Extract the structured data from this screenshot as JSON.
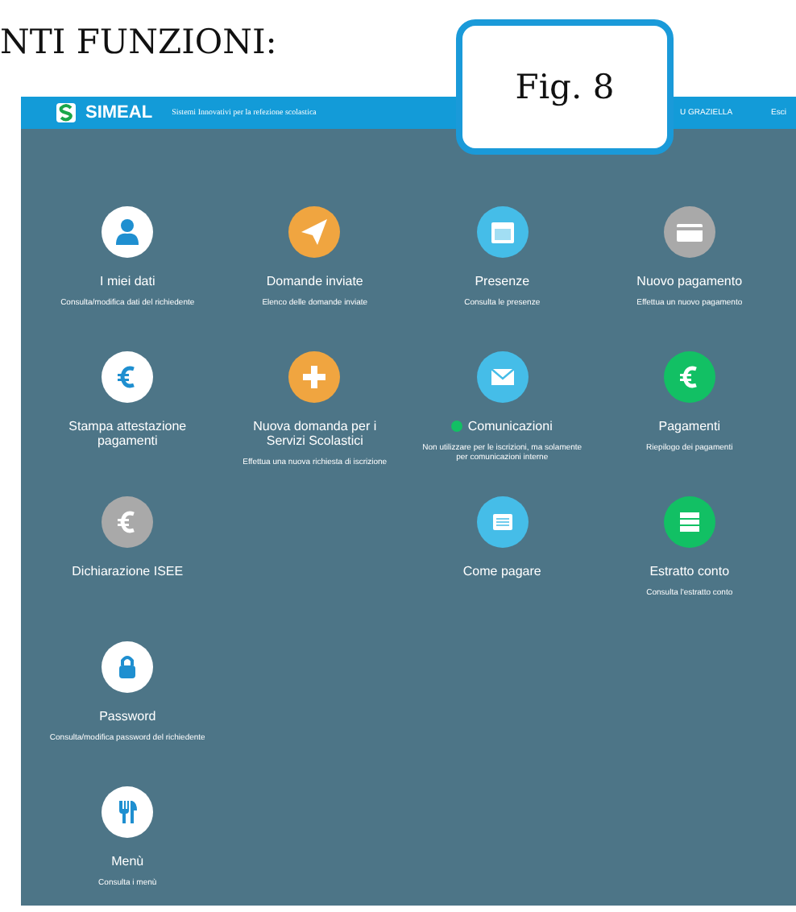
{
  "heading": "NTI FUNZIONI:",
  "callout": {
    "label": "Fig. 8"
  },
  "header": {
    "brand": "SIMEAL",
    "tagline": "Sistemi Innovativi per la refezione scolastica",
    "user": "U GRAZIELLA",
    "logout": "Esci"
  },
  "rows": [
    [
      {
        "kind": "person",
        "color": "#ffffff",
        "title": "I miei dati",
        "subtitle": "Consulta/modifica dati del richiedente",
        "dot": false
      },
      {
        "kind": "plane",
        "color": "#f0a540",
        "title": "Domande inviate",
        "subtitle": "Elenco delle domande inviate",
        "dot": false
      },
      {
        "kind": "calendar",
        "color": "#45bde8",
        "title": "Presenze",
        "subtitle": "Consulta le presenze",
        "dot": false
      },
      {
        "kind": "card",
        "color": "#a9a9a9",
        "title": "Nuovo pagamento",
        "subtitle": "Effettua un nuovo pagamento",
        "dot": false
      }
    ],
    [
      {
        "kind": "euro",
        "color": "#ffffff",
        "title": "Stampa attestazione pagamenti",
        "dot": false
      },
      {
        "kind": "plus",
        "color": "#f0a540",
        "title": "Nuova domanda per i Servizi Scolastici",
        "subtitle": "Effettua una nuova richiesta di iscrizione",
        "dot": false
      },
      {
        "kind": "mail",
        "color": "#45bde8",
        "title": "Comunicazioni",
        "subtitle": "Non utilizzare per le iscrizioni, ma solamente per comunicazioni interne",
        "dot": true
      },
      {
        "kind": "euro",
        "color": "#12c064",
        "title": "Pagamenti",
        "subtitle": "Riepilogo dei pagamenti",
        "dot": false
      }
    ],
    [
      {
        "kind": "euro",
        "color": "#a9a9a9",
        "title": "Dichiarazione ISEE",
        "dot": false
      },
      null,
      {
        "kind": "list",
        "color": "#45bde8",
        "title": "Come pagare",
        "dot": false
      },
      {
        "kind": "ledger",
        "color": "#12c064",
        "title": "Estratto conto",
        "subtitle": "Consulta l'estratto conto",
        "dot": false
      }
    ],
    [
      {
        "kind": "lock",
        "color": "#ffffff",
        "title": "Password",
        "subtitle": "Consulta/modifica password del richiedente",
        "dot": false
      },
      null,
      null,
      null
    ],
    [
      {
        "kind": "cutlery",
        "color": "#ffffff",
        "title": "Menù",
        "subtitle": "Consulta i menù",
        "dot": false
      },
      null,
      null,
      null
    ]
  ]
}
